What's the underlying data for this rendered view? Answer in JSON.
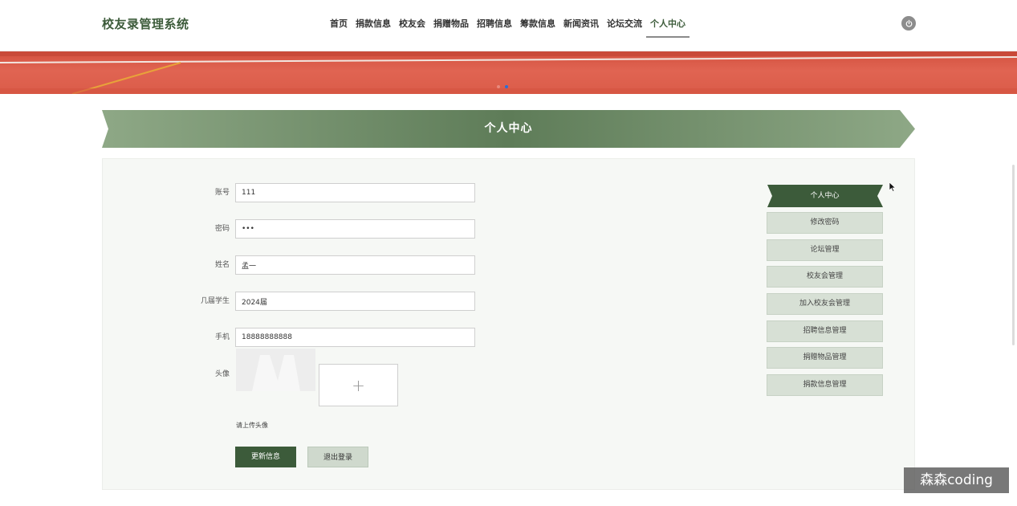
{
  "header": {
    "logo": "校友录管理系统",
    "nav": [
      "首页",
      "捐款信息",
      "校友会",
      "捐赠物品",
      "招聘信息",
      "筹款信息",
      "新闻资讯",
      "论坛交流",
      "个人中心"
    ],
    "active_nav": "个人中心",
    "power_icon": "power-icon"
  },
  "banner": {
    "carousel_dots": 2,
    "active_dot": 2
  },
  "section": {
    "title": "个人中心"
  },
  "form": {
    "fields": [
      {
        "label": "账号",
        "value": "111"
      },
      {
        "label": "密码",
        "value": "•••"
      },
      {
        "label": "姓名",
        "value": "孟一"
      },
      {
        "label": "几届学生",
        "value": "2024届"
      },
      {
        "label": "手机",
        "value": "18888888888"
      }
    ],
    "avatar_label": "头像",
    "upload_plus": "+",
    "upload_hint": "请上传头像",
    "update_button": "更新信息",
    "logout_button": "退出登录"
  },
  "side_menu": {
    "active": "个人中心",
    "items": [
      "修改密码",
      "论坛管理",
      "校友会管理",
      "加入校友会管理",
      "招聘信息管理",
      "捐赠物品管理",
      "捐款信息管理"
    ]
  },
  "watermark": "森森coding",
  "colors": {
    "brand_green": "#3c5b3a",
    "ribbon_green": "#6f8f68",
    "menu_bg": "#d7e0d5",
    "banner_red": "#db5c49",
    "active_dot": "#2b6fd6"
  }
}
